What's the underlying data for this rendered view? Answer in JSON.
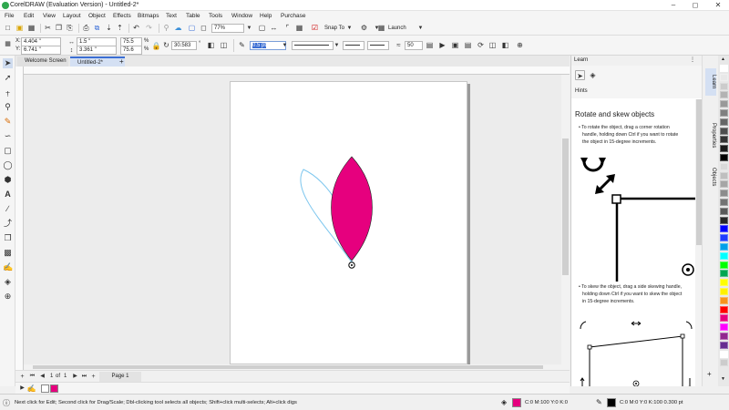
{
  "window": {
    "title": "CorelDRAW (Evaluation Version) - Untitled-2*"
  },
  "menu": [
    "File",
    "Edit",
    "View",
    "Layout",
    "Object",
    "Effects",
    "Bitmaps",
    "Text",
    "Table",
    "Tools",
    "Window",
    "Help",
    "Purchase"
  ],
  "toolbar": {
    "zoom": "77%",
    "snap_label": "Snap To",
    "launch_label": "Launch"
  },
  "propbar": {
    "x": "4.404 \"",
    "y": "6.741 \"",
    "w": "1.5 \"",
    "h": "3.361 \"",
    "scale_w": "75.5",
    "scale_h": "75.6",
    "pct": "%",
    "angle": "30.583",
    "outline_width": "0.5 pt",
    "miter": "50"
  },
  "tabs": [
    "Welcome Screen",
    "Untitled-2*"
  ],
  "tab_add": "+",
  "pagenav": {
    "current": "1",
    "of_label": "of",
    "total": "1",
    "page_tab": "Page 1"
  },
  "learn": {
    "header": "Learn",
    "hints_label": "Hints",
    "heading": "Rotate and skew objects",
    "para1_lines": [
      "• To rotate the object, drag a corner rotation",
      "handle, holding down Ctrl if you want to rotate",
      "the object in 15-degree increments."
    ],
    "para2_lines": [
      "• To skew the object, drag a side skewing handle,",
      "holding down Ctrl if you want to skew the object",
      "in 15-degree increments."
    ]
  },
  "docker_tabs": [
    "Learn",
    "Properties",
    "Objects"
  ],
  "status": {
    "hint": "Next click for Edit; Second click for Drag/Scale; Dbl-clicking tool selects all objects; Shift+click multi-selects; Alt+click digs",
    "fill": "C:0 M:100 Y:0 K:0",
    "outline": "C:0 M:0 Y:0 K:100  0.300 pt"
  },
  "colors": {
    "petal": "#e6007e",
    "palette": [
      "#ffffff",
      "#e8e8e8",
      "#cccccc",
      "#b3b3b3",
      "#999999",
      "#808080",
      "#666666",
      "#4d4d4d",
      "#333333",
      "#1a1a1a",
      "#000000",
      "#d9d9d9",
      "#bfbfbf",
      "#a6a6a6",
      "#8c8c8c",
      "#737373",
      "#595959",
      "#262626",
      "#0000ff",
      "#1e3cff",
      "#00a0e9",
      "#00ffff",
      "#00ff00",
      "#00a651",
      "#ffff00",
      "#fff200",
      "#f7941d",
      "#ff0000",
      "#e6007e",
      "#ff00ff",
      "#92278f",
      "#662d91",
      "#ffffff",
      "#cccccc"
    ]
  }
}
